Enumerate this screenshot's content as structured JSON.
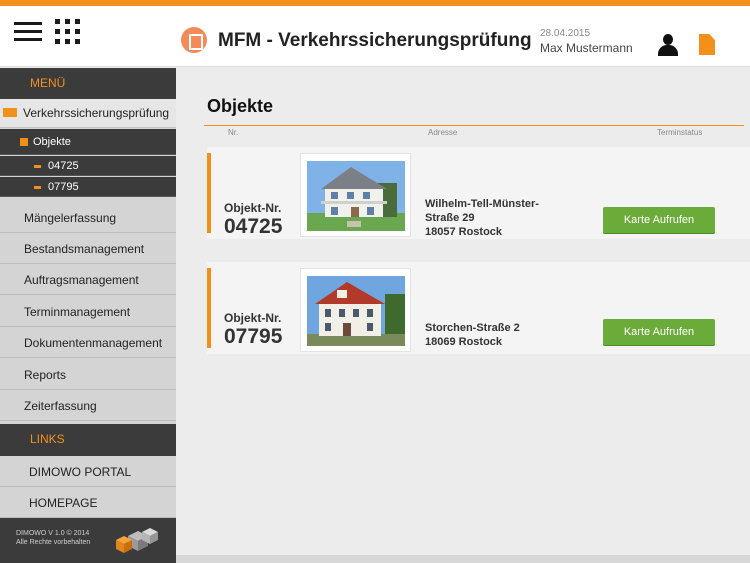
{
  "header": {
    "title": "MFM - Verkehrssicherungsprüfung",
    "date": "28.04.2015",
    "user": "Max Mustermann",
    "icons": [
      "menu-icon",
      "grid-icon",
      "app-logo-icon",
      "user-icon",
      "document-icon"
    ]
  },
  "sidebar": {
    "menu_heading": "MENÜ",
    "active_item": "Verkehrssicherungsprüfung",
    "sub_objekte": "Objekte",
    "sub_items": [
      "04725",
      "07795"
    ],
    "items": [
      "Mängelerfassung",
      "Bestandsmanagement",
      "Auftragsmanagement",
      "Terminmanagement",
      "Dokumentenmanagement",
      "Reports",
      "Zeiterfassung"
    ],
    "links_heading": "LINKS",
    "links": [
      "DIMOWO PORTAL",
      "HOMEPAGE"
    ],
    "footer_line1": "DIMOWO V 1.0 © 2014",
    "footer_line2": "Alle Rechte vorbehalten"
  },
  "main": {
    "title": "Objekte",
    "columns": [
      "Nr.",
      "Adresse",
      "Terminstatus"
    ],
    "objects": [
      {
        "nr_label": "Objekt-Nr.",
        "nr": "04725",
        "address_line1": "Wilhelm-Tell-Münster-",
        "address_line2": "Straße 29",
        "address_line3": "18057 Rostock",
        "button": "Karte Aufrufen"
      },
      {
        "nr_label": "Objekt-Nr.",
        "nr": "07795",
        "address_line1": "Storchen-Straße 2",
        "address_line2": "18069 Rostock",
        "button": "Karte Aufrufen"
      }
    ]
  },
  "colors": {
    "accent": "#f39019",
    "sidebar_dark": "#3b3b3b",
    "button_green": "#6bab39"
  }
}
